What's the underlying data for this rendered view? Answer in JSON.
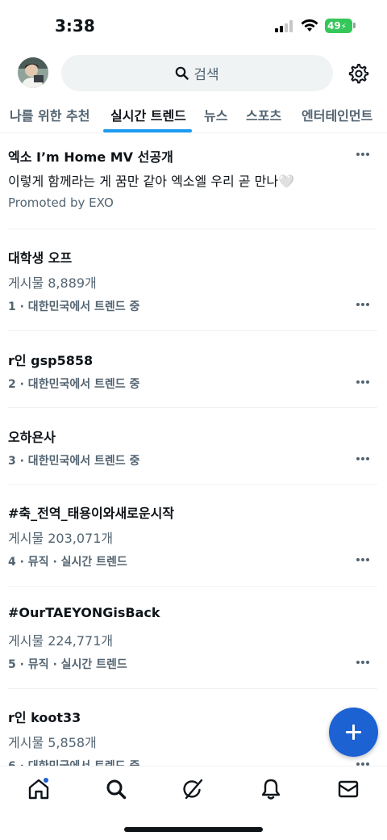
{
  "status_bar": {
    "time": "3:38",
    "battery": "49"
  },
  "header": {
    "search_placeholder": "검색",
    "avatar_icon": "avatar",
    "settings_icon": "gear-icon"
  },
  "tabs": [
    {
      "label": "나를 위한 추천"
    },
    {
      "label": "실시간 트렌드",
      "active": true
    },
    {
      "label": "뉴스"
    },
    {
      "label": "스포츠"
    },
    {
      "label": "엔터테인먼트"
    }
  ],
  "promoted": {
    "title": "엑소 I’m Home MV 선공개",
    "text": "이렇게 함께라는 게 꿈만 같아 엑소엘 우리 곧 만나🤍",
    "promoted_by": "Promoted by EXO"
  },
  "trends": [
    {
      "title": "대학생 오프",
      "posts": "게시물 8,889개",
      "meta": "1 · 대한민국에서 트렌드 중"
    },
    {
      "title": "r인 gsp5858",
      "posts": "",
      "meta": "2 · 대한민국에서 트렌드 중"
    },
    {
      "title": "오하욘사",
      "posts": "",
      "meta": "3 · 대한민국에서 트렌드 중"
    },
    {
      "title": "#축_전역_태용이와새로운시작",
      "posts": "게시물 203,071개",
      "meta": "4 · 뮤직 · 실시간 트렌드"
    },
    {
      "title": "#OurTAEYONGisBack",
      "posts": "게시물 224,771개",
      "meta": "5 · 뮤직 · 실시간 트렌드"
    },
    {
      "title": "r인 koot33",
      "posts": "게시물 5,858개",
      "meta": "6 · 대한민국에서 트렌드 중"
    }
  ],
  "bottom_nav": [
    {
      "icon": "home-icon",
      "has_dot": true
    },
    {
      "icon": "search-icon"
    },
    {
      "icon": "grok-icon"
    },
    {
      "icon": "bell-icon"
    },
    {
      "icon": "mail-icon"
    }
  ],
  "colors": {
    "accent": "#1d9bf0",
    "fab": "#1d62d3",
    "text": "#0f1419",
    "secondary": "#536471"
  }
}
